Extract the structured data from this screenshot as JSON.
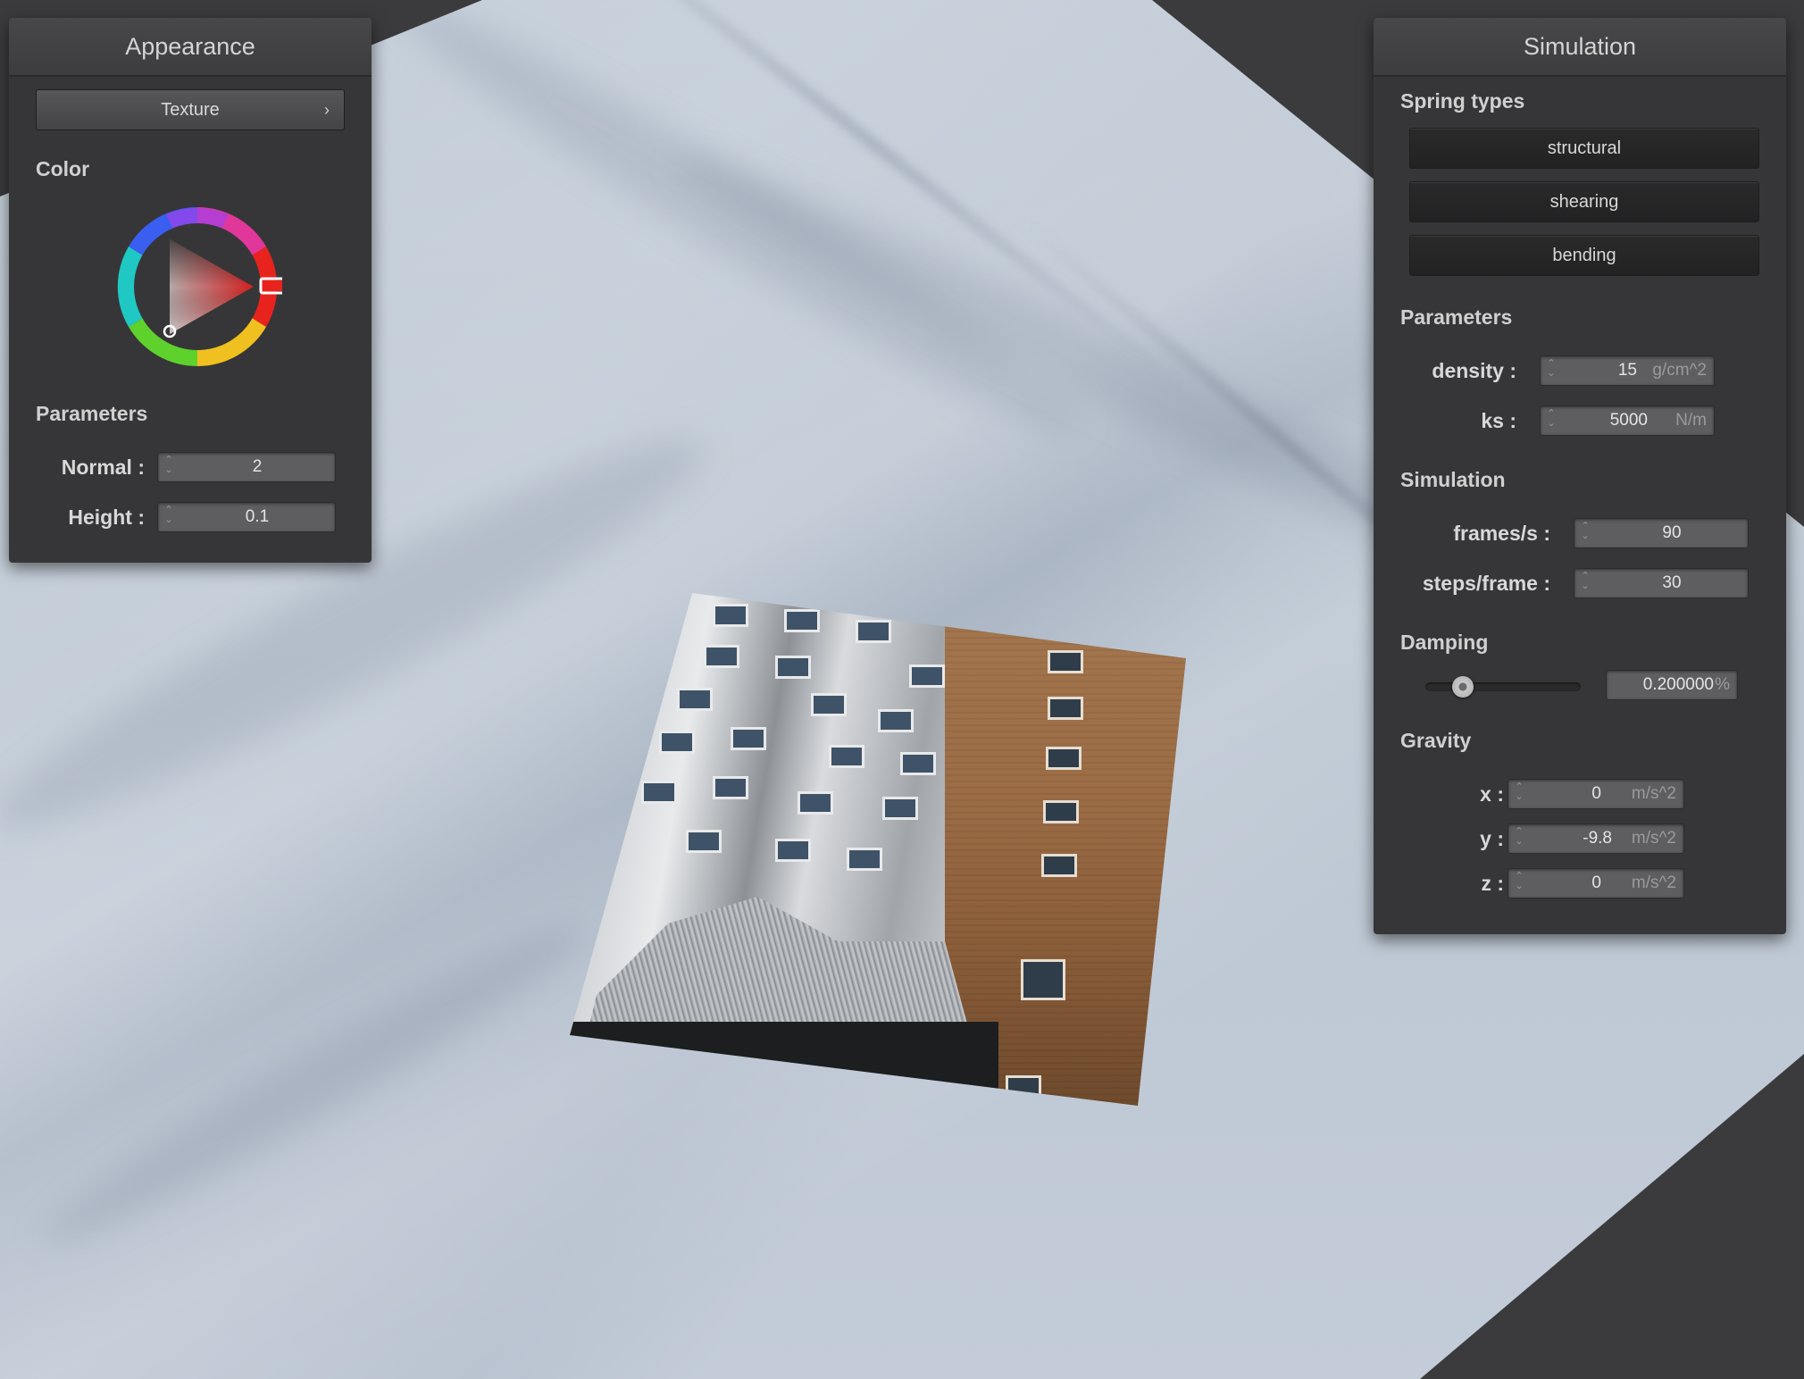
{
  "appearance_panel": {
    "title": "Appearance",
    "texture_button": "Texture",
    "texture_chevron": "›",
    "color_label": "Color",
    "color_value": "#d42020",
    "parameters_label": "Parameters",
    "normal_label": "Normal :",
    "normal_value": "2",
    "height_label": "Height :",
    "height_value": "0.1"
  },
  "simulation_panel": {
    "title": "Simulation",
    "spring_types_label": "Spring types",
    "spring_buttons": [
      "structural",
      "shearing",
      "bending"
    ],
    "parameters_label": "Parameters",
    "density_label": "density :",
    "density_value": "15",
    "density_unit": "g/cm^2",
    "ks_label": "ks :",
    "ks_value": "5000",
    "ks_unit": "N/m",
    "simulation_label": "Simulation",
    "fps_label": "frames/s :",
    "fps_value": "90",
    "steps_label": "steps/frame :",
    "steps_value": "30",
    "damping_label": "Damping",
    "damping_value": "0.200000",
    "damping_unit": "%",
    "damping_slider_fraction": 0.2,
    "gravity_label": "Gravity",
    "gravity_x_label": "x :",
    "gravity_x_value": "0",
    "gravity_y_label": "y :",
    "gravity_y_value": "-9.8",
    "gravity_z_label": "z :",
    "gravity_z_value": "0",
    "gravity_unit": "m/s^2"
  },
  "spinner_glyphs": {
    "up": "⌃",
    "down": "⌄"
  },
  "colors": {
    "panel_bg": "#363638",
    "cloth": "#c2ccd7",
    "scene_dark": "#3b3b3d"
  }
}
